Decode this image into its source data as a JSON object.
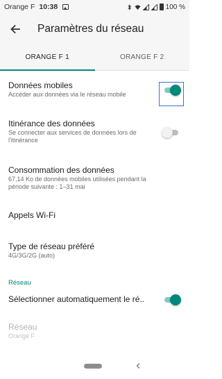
{
  "status_bar": {
    "carrier": "Orange F",
    "time": "10:38",
    "battery": "100 %"
  },
  "header": {
    "title": "Paramètres du réseau"
  },
  "tabs": [
    {
      "label": "ORANGE F 1",
      "active": true
    },
    {
      "label": "ORANGE F 2",
      "active": false
    }
  ],
  "settings": {
    "mobile_data": {
      "title": "Données mobiles",
      "summary": "Accéder aux données via le réseau mobile",
      "enabled": true
    },
    "roaming": {
      "title": "Itinérance des données",
      "summary": "Se connecter aux services de données lors de l'itinérance",
      "enabled": false
    },
    "data_usage": {
      "title": "Consommation des données",
      "summary": "67,14 Ko de données mobiles utilisées pendant la période suivante : 1–31 mai"
    },
    "wifi_calling": {
      "title": "Appels Wi-Fi"
    },
    "network_type": {
      "title": "Type de réseau préféré",
      "summary": "4G/3G/2G (auto)"
    },
    "network_section": {
      "label": "Réseau"
    },
    "auto_select": {
      "title": "Sélectionner automatiquement le ré..",
      "enabled": true
    },
    "network": {
      "title": "Réseau",
      "summary": "Orange F"
    }
  },
  "colors": {
    "accent": "#00897b",
    "focus": "#3f6fd1"
  }
}
